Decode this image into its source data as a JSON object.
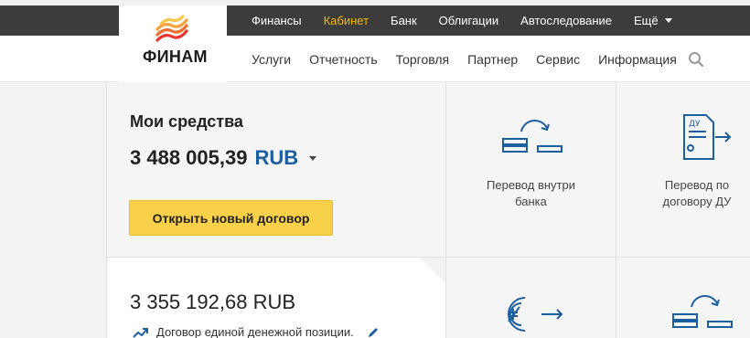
{
  "brand": {
    "name": "ФИНАМ"
  },
  "topnav": {
    "items": [
      {
        "label": "Финансы",
        "active": false
      },
      {
        "label": "Кабинет",
        "active": true
      },
      {
        "label": "Банк",
        "active": false
      },
      {
        "label": "Облигации",
        "active": false
      },
      {
        "label": "Автоследование",
        "active": false
      }
    ],
    "more_label": "Ещё"
  },
  "mainnav": {
    "items": [
      "Услуги",
      "Отчетность",
      "Торговля",
      "Партнер",
      "Сервис",
      "Информация"
    ]
  },
  "funds": {
    "title": "Мои средства",
    "amount": "3 488 005,39",
    "currency": "RUB",
    "open_button": "Открыть новый договор"
  },
  "tiles": [
    {
      "label": "Перевод внутри банка",
      "icon": "bank-transfer-icon"
    },
    {
      "label": "Перевод по договору ДУ",
      "icon": "trust-contract-icon"
    },
    {
      "label": "",
      "icon": "currency-exchange-icon"
    },
    {
      "label": "",
      "icon": "bank-transfer-icon"
    }
  ],
  "contract": {
    "amount": "3 355 192,68 RUB",
    "description": "Договор единой денежной позиции."
  },
  "colors": {
    "accent": "#1c5fa0",
    "button": "#f9d04a",
    "active_nav": "#f5b800",
    "topbar": "#3c3c3c"
  }
}
